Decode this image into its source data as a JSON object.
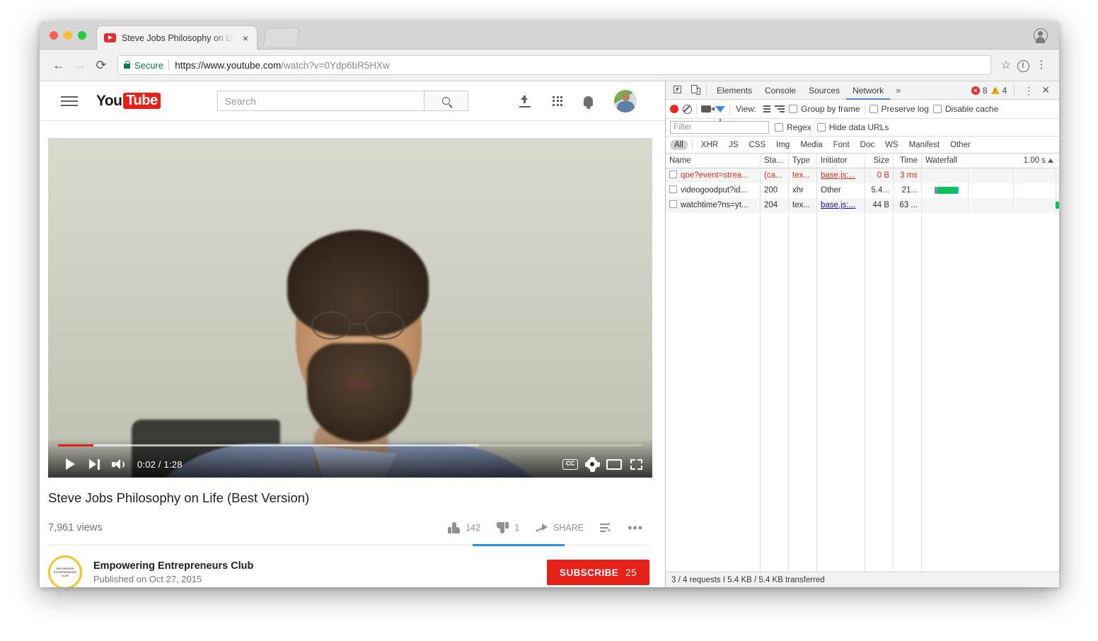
{
  "browser": {
    "tab": {
      "title": "Steve Jobs Philosophy on Life (Best Version) - YouTube",
      "close_label": "×"
    },
    "nav": {
      "back": "←",
      "forward": "→",
      "reload": "⟳"
    },
    "omnibox": {
      "security_label": "Secure",
      "url_scheme": "https://www.youtube.com",
      "url_path": "/watch?v=0Ydp6bR5HXw",
      "star_icon": "☆",
      "info_icon": "!",
      "menu_icon": "⋮"
    }
  },
  "youtube": {
    "search": {
      "placeholder": "Search",
      "value": ""
    },
    "player": {
      "played_percent": 6,
      "buffered_percent": 72,
      "time_current": "0:02",
      "time_total": "1:28",
      "timecode": "0:02 / 1:28",
      "cc_label": "CC"
    },
    "video": {
      "title": "Steve Jobs Philosophy on Life (Best Version)",
      "views": "7,961 views",
      "likes": "142",
      "dislikes": "1",
      "share_label": "SHARE"
    },
    "channel": {
      "avatar_text": "EMPOWERING ENTREPRENEURS CLUB",
      "name": "Empowering Entrepreneurs Club",
      "published": "Published on Oct 27, 2015",
      "subscribe_label": "SUBSCRIBE",
      "subscriber_count": "25",
      "subscribe_color": "#e62117"
    }
  },
  "devtools": {
    "tabs": [
      {
        "label": "Elements",
        "active": false
      },
      {
        "label": "Console",
        "active": false
      },
      {
        "label": "Sources",
        "active": false
      },
      {
        "label": "Network",
        "active": true
      }
    ],
    "more_label": "»",
    "errors": "8",
    "warnings": "4",
    "menu_icon": "⋮",
    "close_icon": "✕",
    "toolbar": {
      "view_label": "View:",
      "group_by_frame": "Group by frame",
      "preserve_log": "Preserve log",
      "disable_cache": "Disable cache"
    },
    "filterbar": {
      "filter_placeholder": "Filter",
      "filter_value": "",
      "regex_label": "Regex",
      "hide_data_urls_label": "Hide data URLs"
    },
    "types": [
      "All",
      "XHR",
      "JS",
      "CSS",
      "Img",
      "Media",
      "Font",
      "Doc",
      "WS",
      "Manifest",
      "Other"
    ],
    "active_type": "All",
    "table": {
      "columns": [
        "Name",
        "Sta...",
        "Type",
        "Initiator",
        "Size",
        "Time",
        "Waterfall"
      ],
      "waterfall_scale": "1.00 s",
      "rows": [
        {
          "name": "qoe?event=strea...",
          "status": "(ca...",
          "type": "tex...",
          "initiator": "base.js:...",
          "size": "0 B",
          "time": "3 ms",
          "error": true,
          "bars": []
        },
        {
          "name": "videogoodput?id...",
          "status": "200",
          "type": "xhr",
          "initiator": "Other",
          "size": "5.4...",
          "time": "21...",
          "error": false,
          "bars": [
            {
              "kind": "queue",
              "left_pct": 9.5,
              "width_pct": 1.6
            },
            {
              "kind": "green",
              "left_pct": 11.1,
              "width_pct": 14.5
            },
            {
              "kind": "blue",
              "left_pct": 25.6,
              "width_pct": 1.3
            }
          ]
        },
        {
          "name": "watchtime?ns=yt...",
          "status": "204",
          "type": "tex...",
          "initiator": "base.js:...",
          "size": "44 B",
          "time": "63 ...",
          "error": false,
          "bars": [
            {
              "kind": "green",
              "left_pct": 97.5,
              "width_pct": 2.5
            }
          ]
        }
      ]
    },
    "status": "3 / 4 requests I 5.4 KB / 5.4 KB transferred"
  }
}
